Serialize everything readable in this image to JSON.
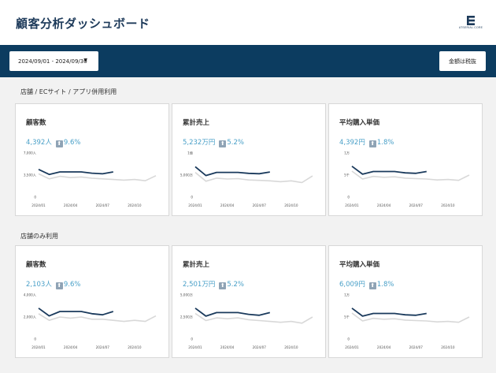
{
  "header": {
    "title": "顧客分析ダッシュボード",
    "logo_text": "ATSERIAL.CORE"
  },
  "toolbar": {
    "date_range": "2024/09/01 - 2024/09/30",
    "caret": "▼",
    "tax_button": "金額は税抜"
  },
  "sections": [
    {
      "title": "店舗 / ECサイト / アプリ併用利用",
      "cards": [
        {
          "title": "顧客数",
          "value": "4,392人",
          "delta": "9.6%",
          "arrow": "⬆",
          "chart_data": {
            "type": "line",
            "x": [
              "2024/01",
              "2024/02",
              "2024/03",
              "2024/04",
              "2024/05",
              "2024/06",
              "2024/07",
              "2024/08",
              "2024/09",
              "2024/10",
              "2024/11",
              "2024/12"
            ],
            "xticks": [
              "2024/01",
              "2024/04",
              "2024/07",
              "2024/10"
            ],
            "yticks": [
              "7,000人",
              "3,500人",
              "0"
            ],
            "ylim": [
              0,
              7000
            ],
            "series": [
              {
                "values": [
                  4400,
                  3600,
                  4000,
                  4000,
                  4000,
                  3800,
                  3700,
                  4000
                ],
                "color": "#1a3a5c"
              },
              {
                "values": [
                  3700,
                  2900,
                  3300,
                  3100,
                  3200,
                  3000,
                  2900,
                  2800,
                  2700,
                  2800,
                  2600,
                  3400
                ],
                "color": "#d8d8d8"
              }
            ]
          }
        },
        {
          "title": "累計売上",
          "value": "5,232万円",
          "delta": "5.2%",
          "arrow": "⬆",
          "chart_data": {
            "type": "line",
            "x": [
              "2024/01",
              "2024/02",
              "2024/03",
              "2024/04",
              "2024/05",
              "2024/06",
              "2024/07",
              "2024/08",
              "2024/09",
              "2024/10",
              "2024/11",
              "2024/12"
            ],
            "xticks": [
              "2024/01",
              "2024/04",
              "2024/07",
              "2024/10"
            ],
            "yticks": [
              "1億",
              "5,000万",
              "0"
            ],
            "ylim": [
              0,
              10000
            ],
            "series": [
              {
                "values": [
                  6900,
                  4900,
                  5600,
                  5600,
                  5600,
                  5400,
                  5300,
                  5700
                ],
                "color": "#1a3a5c"
              },
              {
                "values": [
                  5600,
                  3600,
                  4300,
                  4100,
                  4200,
                  3900,
                  3800,
                  3700,
                  3500,
                  3700,
                  3300,
                  4800
                ],
                "color": "#d8d8d8"
              }
            ]
          }
        },
        {
          "title": "平均購入単価",
          "value": "4,392円",
          "delta": "1.8%",
          "arrow": "⬆",
          "chart_data": {
            "type": "line",
            "x": [
              "2024/01",
              "2024/02",
              "2024/03",
              "2024/04",
              "2024/05",
              "2024/06",
              "2024/07",
              "2024/08",
              "2024/09",
              "2024/10",
              "2024/11",
              "2024/12"
            ],
            "xticks": [
              "2024/01",
              "2024/04",
              "2024/07",
              "2024/10"
            ],
            "yticks": [
              "1万",
              "5千",
              "0"
            ],
            "ylim": [
              0,
              10000
            ],
            "series": [
              {
                "values": [
                  7000,
                  5200,
                  5800,
                  5800,
                  5800,
                  5500,
                  5400,
                  5800
                ],
                "color": "#1a3a5c"
              },
              {
                "values": [
                  5900,
                  4100,
                  4700,
                  4500,
                  4600,
                  4300,
                  4200,
                  4100,
                  3900,
                  4000,
                  3800,
                  5000
                ],
                "color": "#d8d8d8"
              }
            ]
          }
        }
      ]
    },
    {
      "title": "店舗のみ利用",
      "cards": [
        {
          "title": "顧客数",
          "value": "2,103人",
          "delta": "9.6%",
          "arrow": "⬆",
          "chart_data": {
            "type": "line",
            "x": [
              "2024/01",
              "2024/02",
              "2024/03",
              "2024/04",
              "2024/05",
              "2024/06",
              "2024/07",
              "2024/08",
              "2024/09",
              "2024/10",
              "2024/11",
              "2024/12"
            ],
            "xticks": [
              "2024/01",
              "2024/04",
              "2024/07",
              "2024/10"
            ],
            "yticks": [
              "4,000人",
              "2,000人",
              "0"
            ],
            "ylim": [
              0,
              4000
            ],
            "series": [
              {
                "values": [
                  2800,
                  2100,
                  2500,
                  2500,
                  2500,
                  2300,
                  2200,
                  2500
                ],
                "color": "#1a3a5c"
              },
              {
                "values": [
                  2300,
                  1700,
                  2000,
                  1900,
                  2000,
                  1800,
                  1800,
                  1700,
                  1600,
                  1700,
                  1600,
                  2100
                ],
                "color": "#d8d8d8"
              }
            ]
          }
        },
        {
          "title": "累計売上",
          "value": "2,501万円",
          "delta": "5.2%",
          "arrow": "⬆",
          "chart_data": {
            "type": "line",
            "x": [
              "2024/01",
              "2024/02",
              "2024/03",
              "2024/04",
              "2024/05",
              "2024/06",
              "2024/07",
              "2024/08",
              "2024/09",
              "2024/10",
              "2024/11",
              "2024/12"
            ],
            "xticks": [
              "2024/01",
              "2024/04",
              "2024/07",
              "2024/10"
            ],
            "yticks": [
              "5,000万",
              "2,500万",
              "0"
            ],
            "ylim": [
              0,
              5000
            ],
            "series": [
              {
                "values": [
                  3500,
                  2600,
                  3000,
                  3000,
                  3000,
                  2800,
                  2700,
                  3000
                ],
                "color": "#1a3a5c"
              },
              {
                "values": [
                  2900,
                  2100,
                  2400,
                  2300,
                  2400,
                  2200,
                  2100,
                  2000,
                  1900,
                  2000,
                  1800,
                  2500
                ],
                "color": "#d8d8d8"
              }
            ]
          }
        },
        {
          "title": "平均購入単価",
          "value": "6,009円",
          "delta": "1.8%",
          "arrow": "⬆",
          "chart_data": {
            "type": "line",
            "x": [
              "2024/01",
              "2024/02",
              "2024/03",
              "2024/04",
              "2024/05",
              "2024/06",
              "2024/07",
              "2024/08",
              "2024/09",
              "2024/10",
              "2024/11",
              "2024/12"
            ],
            "xticks": [
              "2024/01",
              "2024/04",
              "2024/07",
              "2024/10"
            ],
            "yticks": [
              "1万",
              "5千",
              "0"
            ],
            "ylim": [
              0,
              10000
            ],
            "series": [
              {
                "values": [
                  7000,
                  5200,
                  5800,
                  5800,
                  5800,
                  5500,
                  5400,
                  5800
                ],
                "color": "#1a3a5c"
              },
              {
                "values": [
                  5900,
                  4100,
                  4700,
                  4500,
                  4600,
                  4300,
                  4200,
                  4100,
                  3900,
                  4000,
                  3800,
                  5000
                ],
                "color": "#d8d8d8"
              }
            ]
          }
        }
      ]
    }
  ]
}
